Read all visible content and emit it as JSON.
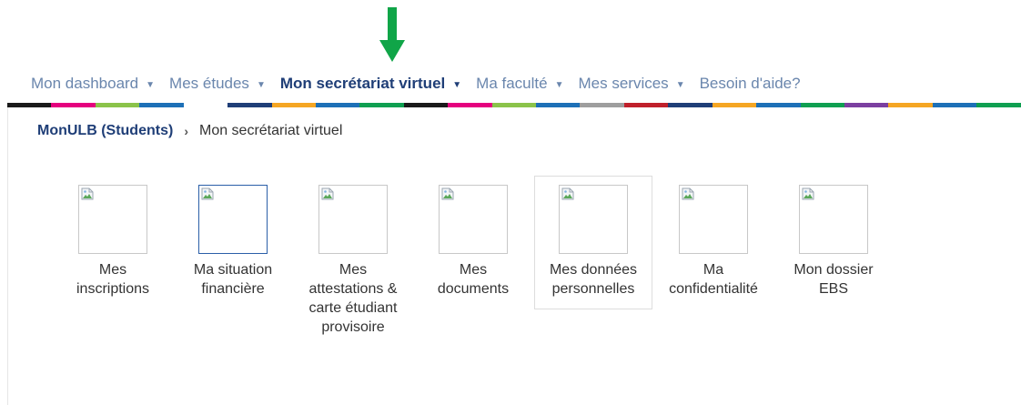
{
  "annotation": {
    "arrow_color": "#10a548"
  },
  "nav": {
    "items": [
      {
        "label": "Mon dashboard",
        "has_caret": true,
        "active": false
      },
      {
        "label": "Mes études",
        "has_caret": true,
        "active": false
      },
      {
        "label": "Mon secrétariat virtuel",
        "has_caret": true,
        "active": true
      },
      {
        "label": "Ma faculté",
        "has_caret": true,
        "active": false
      },
      {
        "label": "Mes services",
        "has_caret": true,
        "active": false
      },
      {
        "label": "Besoin d'aide?",
        "has_caret": false,
        "active": false
      }
    ],
    "caret_glyph": "▼",
    "color_stripes": [
      "#1a1a1a",
      "#e5007e",
      "#8bc34a",
      "#1d70b7",
      "#ffffff",
      "#1f3e77",
      "#f5a623",
      "#1d70b7",
      "#0f9f51",
      "#1a1a1a",
      "#e5007e",
      "#8bc34a",
      "#1d70b7",
      "#9e9e9e",
      "#c0202b",
      "#1f3e77",
      "#f5a623",
      "#1d70b7",
      "#0f9f51",
      "#7b3fa0",
      "#f5a623",
      "#1d70b7",
      "#0f9f51"
    ]
  },
  "breadcrumb": {
    "root": "MonULB (Students)",
    "separator": "›",
    "current": "Mon secrétariat virtuel"
  },
  "tiles": [
    {
      "label": "Mes\ninscriptions",
      "icon": "broken-image-icon"
    },
    {
      "label": "Ma situation\nfinancière",
      "icon": "broken-image-icon"
    },
    {
      "label": "Mes\nattestations &\ncarte étudiant\nprovisoire",
      "icon": "broken-image-icon"
    },
    {
      "label": "Mes\ndocuments",
      "icon": "broken-image-icon"
    },
    {
      "label": "Mes données\npersonnelles",
      "icon": "broken-image-icon"
    },
    {
      "label": "Ma\nconfidentialité",
      "icon": "broken-image-icon"
    },
    {
      "label": "Mon dossier\nEBS",
      "icon": "broken-image-icon"
    }
  ]
}
